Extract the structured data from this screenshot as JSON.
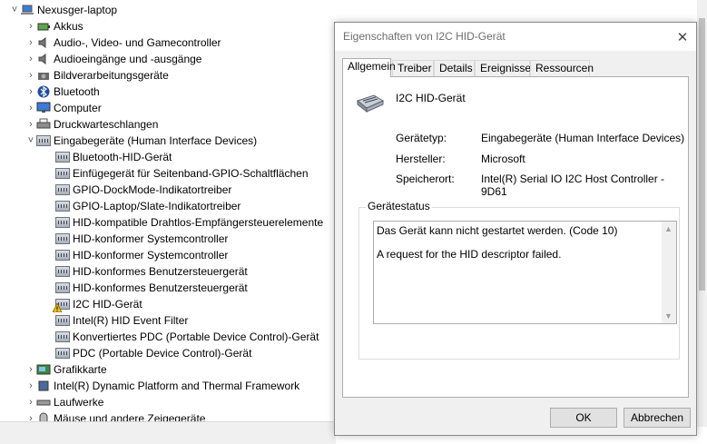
{
  "tree": {
    "root": "Nexusger-laptop",
    "categories": [
      {
        "label": "Akkus",
        "icon": "battery-icon"
      },
      {
        "label": "Audio-, Video- und Gamecontroller",
        "icon": "speaker-icon"
      },
      {
        "label": "Audioeingänge und -ausgänge",
        "icon": "speaker-icon"
      },
      {
        "label": "Bildverarbeitungsgeräte",
        "icon": "camera-icon"
      },
      {
        "label": "Bluetooth",
        "icon": "bluetooth-icon"
      },
      {
        "label": "Computer",
        "icon": "monitor-icon"
      },
      {
        "label": "Druckwarteschlangen",
        "icon": "printer-icon"
      },
      {
        "label": "Eingabegeräte (Human Interface Devices)",
        "icon": "hid-icon"
      }
    ],
    "hid_children": [
      "Bluetooth-HID-Gerät",
      "Einfügegerät für Seitenband-GPIO-Schaltflächen",
      "GPIO-DockMode-Indikatortreiber",
      "GPIO-Laptop/Slate-Indikatortreiber",
      "HID-kompatible Drahtlos-Empfängersteuerelemente",
      "HID-konformer Systemcontroller",
      "HID-konformer Systemcontroller",
      "HID-konformes Benutzersteuergerät",
      "HID-konformes Benutzersteuergerät",
      "I2C HID-Gerät",
      "Intel(R) HID Event Filter",
      "Konvertiertes PDC (Portable Device Control)-Gerät",
      "PDC (Portable Device Control)-Gerät"
    ],
    "after_categories": [
      {
        "label": "Grafikkarte",
        "icon": "display-adapter-icon"
      },
      {
        "label": "Intel(R) Dynamic Platform and Thermal Framework",
        "icon": "chip-icon"
      },
      {
        "label": "Laufwerke",
        "icon": "drive-icon"
      },
      {
        "label": "Mäuse und andere Zeigegeräte",
        "icon": "mouse-icon"
      }
    ]
  },
  "dialog": {
    "title": "Eigenschaften von I2C HID-Gerät",
    "tabs": [
      "Allgemein",
      "Treiber",
      "Details",
      "Ereignisse",
      "Ressourcen"
    ],
    "device_name": "I2C HID-Gerät",
    "props": [
      {
        "label": "Gerätetyp:",
        "value": "Eingabegeräte (Human Interface Devices)"
      },
      {
        "label": "Hersteller:",
        "value": "Microsoft"
      },
      {
        "label": "Speicherort:",
        "value": "Intel(R) Serial IO I2C Host Controller - 9D61"
      }
    ],
    "status_group_label": "Gerätestatus",
    "status_line1": "Das Gerät kann nicht gestartet werden. (Code 10)",
    "status_line2": "A request for the HID descriptor failed.",
    "ok": "OK",
    "cancel": "Abbrechen"
  }
}
